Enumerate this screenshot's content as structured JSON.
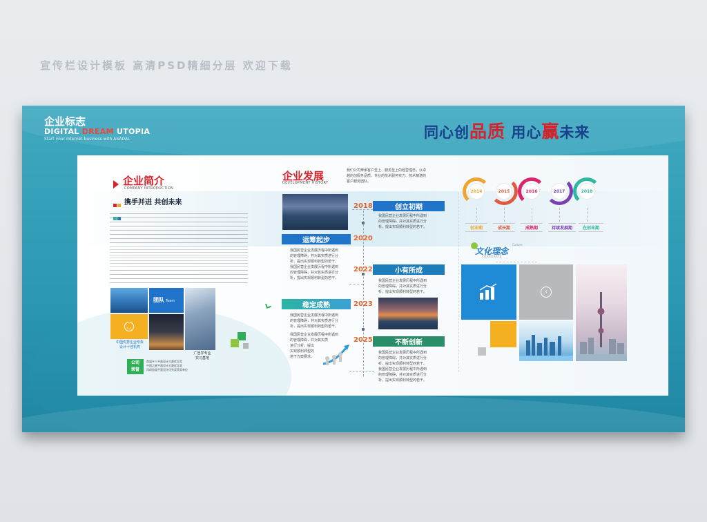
{
  "top_caption": "宣传栏设计模板 高清PSD精细分层 欢迎下载",
  "logo": {
    "main": "企业标志",
    "sub_part1": "DIGITAL ",
    "sub_part2": "DREAM",
    "sub_part3": " UTOPIA",
    "tagline": "Start your internet business with ASADAL"
  },
  "slogan": {
    "part1": "同心创",
    "part2": "品质",
    "part3": " 用心",
    "part4": "赢",
    "part5": "未来"
  },
  "intro": {
    "title": "企业简介",
    "title_en": "COMPANY INTRODUCTION",
    "motto": "携手并进 共创未来",
    "team_label": "团队",
    "team_label_en": "Team",
    "award_text_1": "中国优秀企业形象",
    "award_text_2": "设计十佳机构",
    "base_text_1": "广告学专业",
    "base_text_2": "实习基地",
    "honor_1": "公司",
    "honor_2": "荣誉",
    "honor_lines_1": "首届平人平面设计大赛优异奖",
    "honor_lines_2": "中国之星平面设计大赛优异奖",
    "honor_lines_3": "深圳首届平面设计优秀奖获奖单位"
  },
  "development": {
    "title": "企业发展",
    "title_en": "DEVELOPMENT HISTORY",
    "desc_1": "我们公司秉承客户至上、服务至上的经营理念，以卓",
    "desc_2": "越的创服务品质、专业的技术服务实力、技术精湛的",
    "desc_3": "客户服务团队。",
    "milestones": [
      {
        "year": "2018",
        "label": "创立初期"
      },
      {
        "year": "2020",
        "label": "运筹起步"
      },
      {
        "year": "2022",
        "label": "小有所成"
      },
      {
        "year": "2023",
        "label": "稳定成熟"
      },
      {
        "year": "2025",
        "label": "不断创新"
      }
    ],
    "milestone_text_1": "我国民营企业发展历程中所遇到",
    "milestone_text_2": "的管理障碍，并对其实质进行分",
    "milestone_text_3": "析，提出实现顺利转型的若干。",
    "short_1": "我国民营企业发展历程中所遇到",
    "short_2": "的管理障碍，并对其实质",
    "short_3": "进行分析，提出",
    "short_4": "实现顺利转型的",
    "short_5": "若干方案要求。"
  },
  "stepper": {
    "steps": [
      {
        "year": "2014",
        "label": "创业期",
        "color": "#f1a431"
      },
      {
        "year": "2015",
        "label": "成长期",
        "color": "#e05a3f"
      },
      {
        "year": "2016",
        "label": "成熟期",
        "color": "#d9266d"
      },
      {
        "year": "2017",
        "label": "持续发展期",
        "color": "#7a3fb3"
      },
      {
        "year": "2018",
        "label": "在创业期",
        "color": "#2fb8a0"
      }
    ]
  },
  "culture": {
    "title": "文化理念",
    "culture_en": "Culture",
    "corporate_en": "CORPORATE"
  },
  "colors": {
    "accent_red": "#d4232a",
    "brand_blue": "#17418a",
    "board_teal": "#2b97b2"
  }
}
